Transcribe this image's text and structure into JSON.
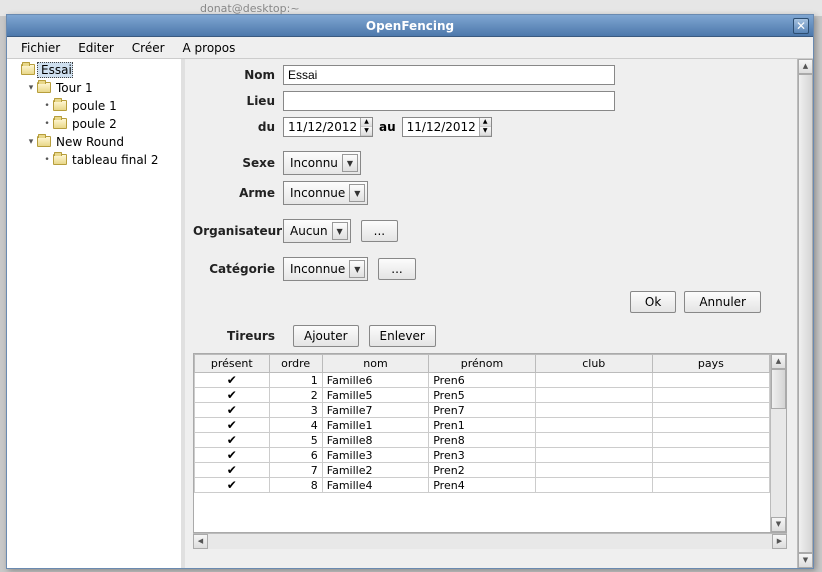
{
  "bg_strip": "donat@desktop:~",
  "window": {
    "title": "OpenFencing"
  },
  "menubar": [
    "Fichier",
    "Editer",
    "Créer",
    "A propos"
  ],
  "tree": [
    {
      "label": "Essai",
      "indent": 0,
      "handle": "",
      "selected": true
    },
    {
      "label": "Tour 1",
      "indent": 1,
      "handle": "⊟"
    },
    {
      "label": "poule 1",
      "indent": 2,
      "handle": "⊶"
    },
    {
      "label": "poule 2",
      "indent": 2,
      "handle": "⊶"
    },
    {
      "label": "New Round",
      "indent": 1,
      "handle": "⊟"
    },
    {
      "label": "tableau final 2",
      "indent": 2,
      "handle": "⊶"
    }
  ],
  "form": {
    "nom_label": "Nom",
    "nom_value": "Essai",
    "lieu_label": "Lieu",
    "lieu_value": "",
    "du_label": "du",
    "du_value": "11/12/2012",
    "au_label": "au",
    "au_value": "11/12/2012",
    "sexe_label": "Sexe",
    "sexe_value": "Inconnu",
    "arme_label": "Arme",
    "arme_value": "Inconnue",
    "organisateur_label": "Organisateur",
    "organisateur_value": "Aucun",
    "categorie_label": "Catégorie",
    "categorie_value": "Inconnue",
    "dots": "...",
    "ok": "Ok",
    "annuler": "Annuler"
  },
  "tireurs": {
    "label": "Tireurs",
    "ajouter": "Ajouter",
    "enlever": "Enlever",
    "columns": [
      "présent",
      "ordre",
      "nom",
      "prénom",
      "club",
      "pays"
    ],
    "rows": [
      {
        "present": true,
        "ordre": 1,
        "nom": "Famille6",
        "prenom": "Pren6",
        "club": "",
        "pays": ""
      },
      {
        "present": true,
        "ordre": 2,
        "nom": "Famille5",
        "prenom": "Pren5",
        "club": "",
        "pays": ""
      },
      {
        "present": true,
        "ordre": 3,
        "nom": "Famille7",
        "prenom": "Pren7",
        "club": "",
        "pays": ""
      },
      {
        "present": true,
        "ordre": 4,
        "nom": "Famille1",
        "prenom": "Pren1",
        "club": "",
        "pays": ""
      },
      {
        "present": true,
        "ordre": 5,
        "nom": "Famille8",
        "prenom": "Pren8",
        "club": "",
        "pays": ""
      },
      {
        "present": true,
        "ordre": 6,
        "nom": "Famille3",
        "prenom": "Pren3",
        "club": "",
        "pays": ""
      },
      {
        "present": true,
        "ordre": 7,
        "nom": "Famille2",
        "prenom": "Pren2",
        "club": "",
        "pays": ""
      },
      {
        "present": true,
        "ordre": 8,
        "nom": "Famille4",
        "prenom": "Pren4",
        "club": "",
        "pays": ""
      }
    ]
  }
}
